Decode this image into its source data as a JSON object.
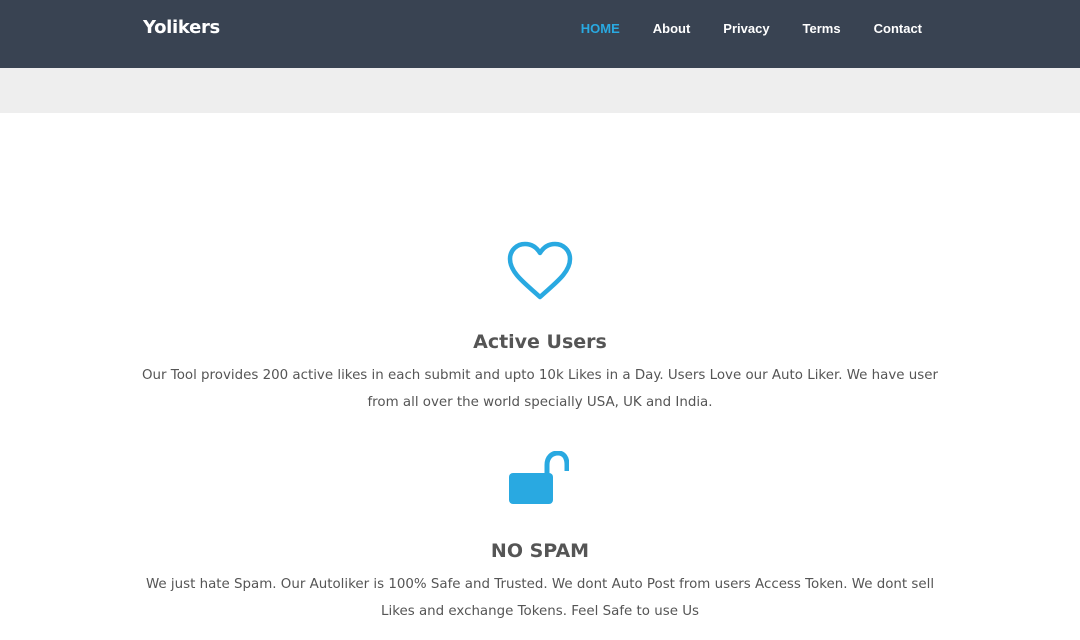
{
  "header": {
    "brand": "Yolikers",
    "nav": [
      {
        "label": "HOME",
        "active": true
      },
      {
        "label": "About",
        "active": false
      },
      {
        "label": "Privacy",
        "active": false
      },
      {
        "label": "Terms",
        "active": false
      },
      {
        "label": "Contact",
        "active": false
      }
    ]
  },
  "colors": {
    "navbar": "#394352",
    "accent": "#29a9e1",
    "strip": "#eeeeee",
    "text": "#555555"
  },
  "features": [
    {
      "icon": "heart-icon",
      "title": "Active Users",
      "text": "Our Tool provides 200 active likes in each submit and upto 10k Likes in a Day. Users Love our Auto Liker. We have user from all over the world specially USA, UK and India."
    },
    {
      "icon": "unlock-icon",
      "title": "NO SPAM",
      "text": "We just hate Spam. Our Autoliker is 100% Safe and Trusted. We dont Auto Post from users Access Token. We dont sell Likes and exchange Tokens. Feel Safe to use Us"
    }
  ]
}
